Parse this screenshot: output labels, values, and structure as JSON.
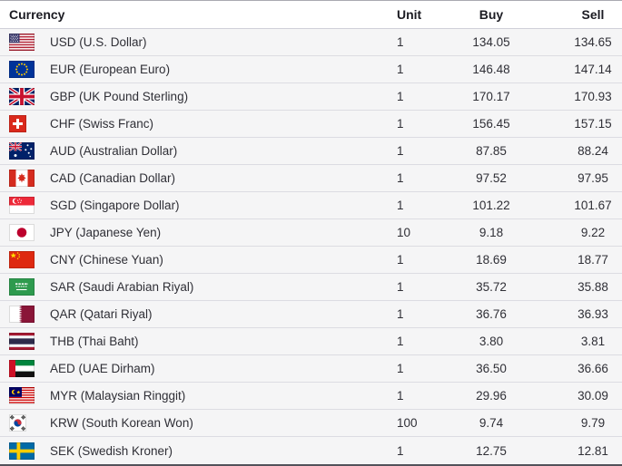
{
  "table": {
    "headers": {
      "currency": "Currency",
      "unit": "Unit",
      "buy": "Buy",
      "sell": "Sell"
    },
    "rows": [
      {
        "code": "USD",
        "label": "USD (U.S. Dollar)",
        "unit": "1",
        "buy": "134.05",
        "sell": "134.65",
        "flag_icon": "us-flag-icon"
      },
      {
        "code": "EUR",
        "label": "EUR (European Euro)",
        "unit": "1",
        "buy": "146.48",
        "sell": "147.14",
        "flag_icon": "eu-flag-icon"
      },
      {
        "code": "GBP",
        "label": "GBP (UK Pound Sterling)",
        "unit": "1",
        "buy": "170.17",
        "sell": "170.93",
        "flag_icon": "uk-flag-icon"
      },
      {
        "code": "CHF",
        "label": "CHF (Swiss Franc)",
        "unit": "1",
        "buy": "156.45",
        "sell": "157.15",
        "flag_icon": "switzerland-flag-icon"
      },
      {
        "code": "AUD",
        "label": "AUD (Australian Dollar)",
        "unit": "1",
        "buy": "87.85",
        "sell": "88.24",
        "flag_icon": "australia-flag-icon"
      },
      {
        "code": "CAD",
        "label": "CAD (Canadian Dollar)",
        "unit": "1",
        "buy": "97.52",
        "sell": "97.95",
        "flag_icon": "canada-flag-icon"
      },
      {
        "code": "SGD",
        "label": "SGD (Singapore Dollar)",
        "unit": "1",
        "buy": "101.22",
        "sell": "101.67",
        "flag_icon": "singapore-flag-icon"
      },
      {
        "code": "JPY",
        "label": "JPY (Japanese Yen)",
        "unit": "10",
        "buy": "9.18",
        "sell": "9.22",
        "flag_icon": "japan-flag-icon"
      },
      {
        "code": "CNY",
        "label": "CNY (Chinese Yuan)",
        "unit": "1",
        "buy": "18.69",
        "sell": "18.77",
        "flag_icon": "china-flag-icon"
      },
      {
        "code": "SAR",
        "label": "SAR (Saudi Arabian Riyal)",
        "unit": "1",
        "buy": "35.72",
        "sell": "35.88",
        "flag_icon": "saudi-arabia-flag-icon"
      },
      {
        "code": "QAR",
        "label": "QAR (Qatari Riyal)",
        "unit": "1",
        "buy": "36.76",
        "sell": "36.93",
        "flag_icon": "qatar-flag-icon"
      },
      {
        "code": "THB",
        "label": "THB (Thai Baht)",
        "unit": "1",
        "buy": "3.80",
        "sell": "3.81",
        "flag_icon": "thailand-flag-icon"
      },
      {
        "code": "AED",
        "label": "AED (UAE Dirham)",
        "unit": "1",
        "buy": "36.50",
        "sell": "36.66",
        "flag_icon": "uae-flag-icon"
      },
      {
        "code": "MYR",
        "label": "MYR (Malaysian Ringgit)",
        "unit": "1",
        "buy": "29.96",
        "sell": "30.09",
        "flag_icon": "malaysia-flag-icon"
      },
      {
        "code": "KRW",
        "label": "KRW (South Korean Won)",
        "unit": "100",
        "buy": "9.74",
        "sell": "9.79",
        "flag_icon": "south-korea-flag-icon"
      },
      {
        "code": "SEK",
        "label": "SEK (Swedish Kroner)",
        "unit": "1",
        "buy": "12.75",
        "sell": "12.81",
        "flag_icon": "sweden-flag-icon"
      }
    ]
  },
  "colors": {
    "row_background": "#f5f5f6",
    "row_separator": "#dcdce2",
    "header_separator": "#cfcfd8",
    "top_border": "#a9a9b1",
    "bottom_border": "#52525a",
    "header_text": "#1b1b22",
    "cell_text": "#2f2f36"
  }
}
